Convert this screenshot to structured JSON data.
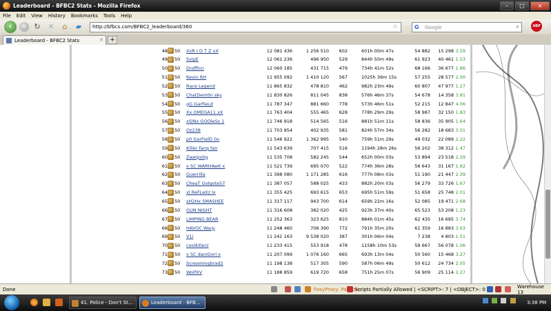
{
  "window": {
    "title": "Leaderboard - BFBC2 Stats - Mozilla Firefox"
  },
  "menu": [
    "File",
    "Edit",
    "View",
    "History",
    "Bookmarks",
    "Tools",
    "Help"
  ],
  "url": "http://bfbcs.com/BFBC2_leaderboard/360",
  "search": {
    "placeholder": "Google"
  },
  "tab": {
    "label": "Leaderboard - BFBC2 Stats"
  },
  "rows": [
    {
      "rank": "48",
      "lvl": "50",
      "name": "XxR I O T Z xX",
      "score": "12 081 436",
      "kills": "1 256 510",
      "deaths": "602",
      "time": "601h 00m 47s",
      "k2": "54 882",
      "k3": "15 298",
      "ratio": "3.59"
    },
    {
      "rank": "49",
      "lvl": "50",
      "name": "SvipE",
      "score": "12 061 236",
      "kills": "496 950",
      "deaths": "529",
      "time": "844h 50m 49s",
      "k2": "61 923",
      "k3": "40 461",
      "ratio": "1.53"
    },
    {
      "rank": "50",
      "lvl": "50",
      "name": "Droffinn",
      "score": "12 060 185",
      "kills": "431 715",
      "deaths": "479",
      "time": "734h 41m 52s",
      "k2": "68 166",
      "k3": "36 677",
      "ratio": "1.86"
    },
    {
      "rank": "51",
      "lvl": "50",
      "name": "Kevin RH",
      "score": "11 955 092",
      "kills": "1 410 120",
      "deaths": "567",
      "time": "1025h 39m 15s",
      "k2": "57 255",
      "k3": "28 577",
      "ratio": "2.00"
    },
    {
      "rank": "52",
      "lvl": "50",
      "name": "Race Legend",
      "score": "11 865 832",
      "kills": "478 810",
      "deaths": "462",
      "time": "982h 23m 49s",
      "k2": "60 807",
      "k3": "47 977",
      "ratio": "1.27"
    },
    {
      "rank": "53",
      "lvl": "50",
      "name": "ChatDem0n sky",
      "score": "11 830 826",
      "kills": "811 045",
      "deaths": "838",
      "time": "576h 46m 37s",
      "k2": "54 678",
      "k3": "14 358",
      "ratio": "3.81"
    },
    {
      "rank": "54",
      "lvl": "50",
      "name": "gG GarfieLd",
      "score": "11 787 347",
      "kills": "881 660",
      "deaths": "778",
      "time": "573h 46m 51s",
      "k2": "52 215",
      "k3": "12 847",
      "ratio": "4.06"
    },
    {
      "rank": "55",
      "lvl": "50",
      "name": "Xx OMEGA11 xX",
      "score": "11 763 404",
      "kills": "555 465",
      "deaths": "628",
      "time": "778h 29m 29s",
      "k2": "58 987",
      "k3": "32 150",
      "ratio": "1.83"
    },
    {
      "rank": "56",
      "lvl": "50",
      "name": "xSiNx GODleSs 1",
      "score": "11 746 918",
      "kills": "514 565",
      "deaths": "516",
      "time": "881h 51m 11s",
      "k2": "58 836",
      "k3": "35 905",
      "ratio": "1.64"
    },
    {
      "rank": "57",
      "lvl": "50",
      "name": "Oz238",
      "score": "11 703 954",
      "kills": "402 935",
      "deaths": "581",
      "time": "824h 57m 34s",
      "k2": "56 282",
      "k3": "18 683",
      "ratio": "3.01"
    },
    {
      "rank": "58",
      "lvl": "50",
      "name": "p0 GarFielD 0o",
      "score": "11 546 922",
      "kills": "1 362 995",
      "deaths": "540",
      "time": "759h 51m 29s",
      "k2": "49 032",
      "k3": "22 089",
      "ratio": "2.22"
    },
    {
      "rank": "59",
      "lvl": "50",
      "name": "Killer fang fan",
      "score": "11 543 639",
      "kills": "707 415",
      "deaths": "516",
      "time": "1194h 28m 26s",
      "k2": "56 202",
      "k3": "38 312",
      "ratio": "1.47"
    },
    {
      "rank": "60",
      "lvl": "50",
      "name": "Zweipolig",
      "score": "11 535 708",
      "kills": "582 245",
      "deaths": "544",
      "time": "652h 00m 03s",
      "k2": "53 894",
      "k3": "23 518",
      "ratio": "2.29"
    },
    {
      "rank": "61",
      "lvl": "50",
      "name": "x SC WARHAwK x",
      "score": "11 521 739",
      "kills": "695 070",
      "deaths": "522",
      "time": "774h 36m 28s",
      "k2": "56 643",
      "k3": "31 167",
      "ratio": "1.82"
    },
    {
      "rank": "62",
      "lvl": "50",
      "name": "Guerrilla",
      "score": "11 398 080",
      "kills": "1 171 285",
      "deaths": "616",
      "time": "777h 08m 03s",
      "k2": "51 190",
      "k3": "21 447",
      "ratio": "2.39"
    },
    {
      "rank": "63",
      "lvl": "50",
      "name": "CheaT Golgote57",
      "score": "11 387 057",
      "kills": "588 025",
      "deaths": "433",
      "time": "882h 20m 03s",
      "k2": "56 279",
      "k3": "33 726",
      "ratio": "1.67"
    },
    {
      "rank": "64",
      "lvl": "50",
      "name": "xl ReFLeXz lx",
      "score": "11 355 425",
      "kills": "693 615",
      "deaths": "653",
      "time": "695h 51m 59s",
      "k2": "51 658",
      "k3": "25 748",
      "ratio": "2.01"
    },
    {
      "rank": "65",
      "lvl": "50",
      "name": "sH2Hx SMASHEE",
      "score": "11 317 117",
      "kills": "943 700",
      "deaths": "614",
      "time": "659h 22m 16s",
      "k2": "52 085",
      "k3": "19 471",
      "ratio": "2.68"
    },
    {
      "rank": "66",
      "lvl": "50",
      "name": "GUN NIGHT",
      "score": "11 316 608",
      "kills": "382 020",
      "deaths": "425",
      "time": "923h 37m 40s",
      "k2": "65 523",
      "k3": "53 208",
      "ratio": "1.23"
    },
    {
      "rank": "67",
      "lvl": "50",
      "name": "LIMPING BEAR",
      "score": "11 252 363",
      "kills": "323 625",
      "deaths": "810",
      "time": "884h 01m 45s",
      "k2": "62 435",
      "k3": "16 695",
      "ratio": "3.74"
    },
    {
      "rank": "68",
      "lvl": "50",
      "name": "HAVOC Warp",
      "score": "11 248 460",
      "kills": "706 390",
      "deaths": "772",
      "time": "791h 35m 20s",
      "k2": "61 359",
      "k3": "16 883",
      "ratio": "3.63"
    },
    {
      "rank": "69",
      "lvl": "50",
      "name": "V1i",
      "score": "11 241 163",
      "kills": "9 538 020",
      "deaths": "387",
      "time": "301h 06m 04s",
      "k2": "7 238",
      "k3": "4 803",
      "ratio": "1.51"
    },
    {
      "rank": "70",
      "lvl": "50",
      "name": "coolkillerz",
      "score": "11 233 415",
      "kills": "553 918",
      "deaths": "478",
      "time": "1158h 10m 53s",
      "k2": "59 667",
      "k3": "56 078",
      "ratio": "1.06"
    },
    {
      "rank": "71",
      "lvl": "50",
      "name": "x SC daniGori x",
      "score": "11 207 099",
      "kills": "1 076 160",
      "deaths": "665",
      "time": "693h 13m 04s",
      "k2": "50 560",
      "k3": "15 468",
      "ratio": "3.27"
    },
    {
      "rank": "72",
      "lvl": "50",
      "name": "Screamingbrad2",
      "score": "11 198 138",
      "kills": "517 305",
      "deaths": "590",
      "time": "587h 06m 49s",
      "k2": "50 612",
      "k3": "24 734",
      "ratio": "2.05"
    },
    {
      "rank": "73",
      "lvl": "50",
      "name": "WolfXV",
      "score": "11 188 859",
      "kills": "619 720",
      "deaths": "658",
      "time": "751h 25m 07s",
      "k2": "56 909",
      "k3": "25 114",
      "ratio": "2.27"
    }
  ],
  "status": {
    "done": "Done",
    "foxyproxy": "FoxyProxy: Patterns",
    "scripts": "Scripts Partially Allowed | <SCRIPT>: 7 | <OBJECT>: 0",
    "warehouse": "Warehouse 13"
  },
  "taskbar": {
    "task1": "41. Police - Don't St...",
    "task2": "Leaderboard - BFB...",
    "clock": "3:38 PM"
  }
}
